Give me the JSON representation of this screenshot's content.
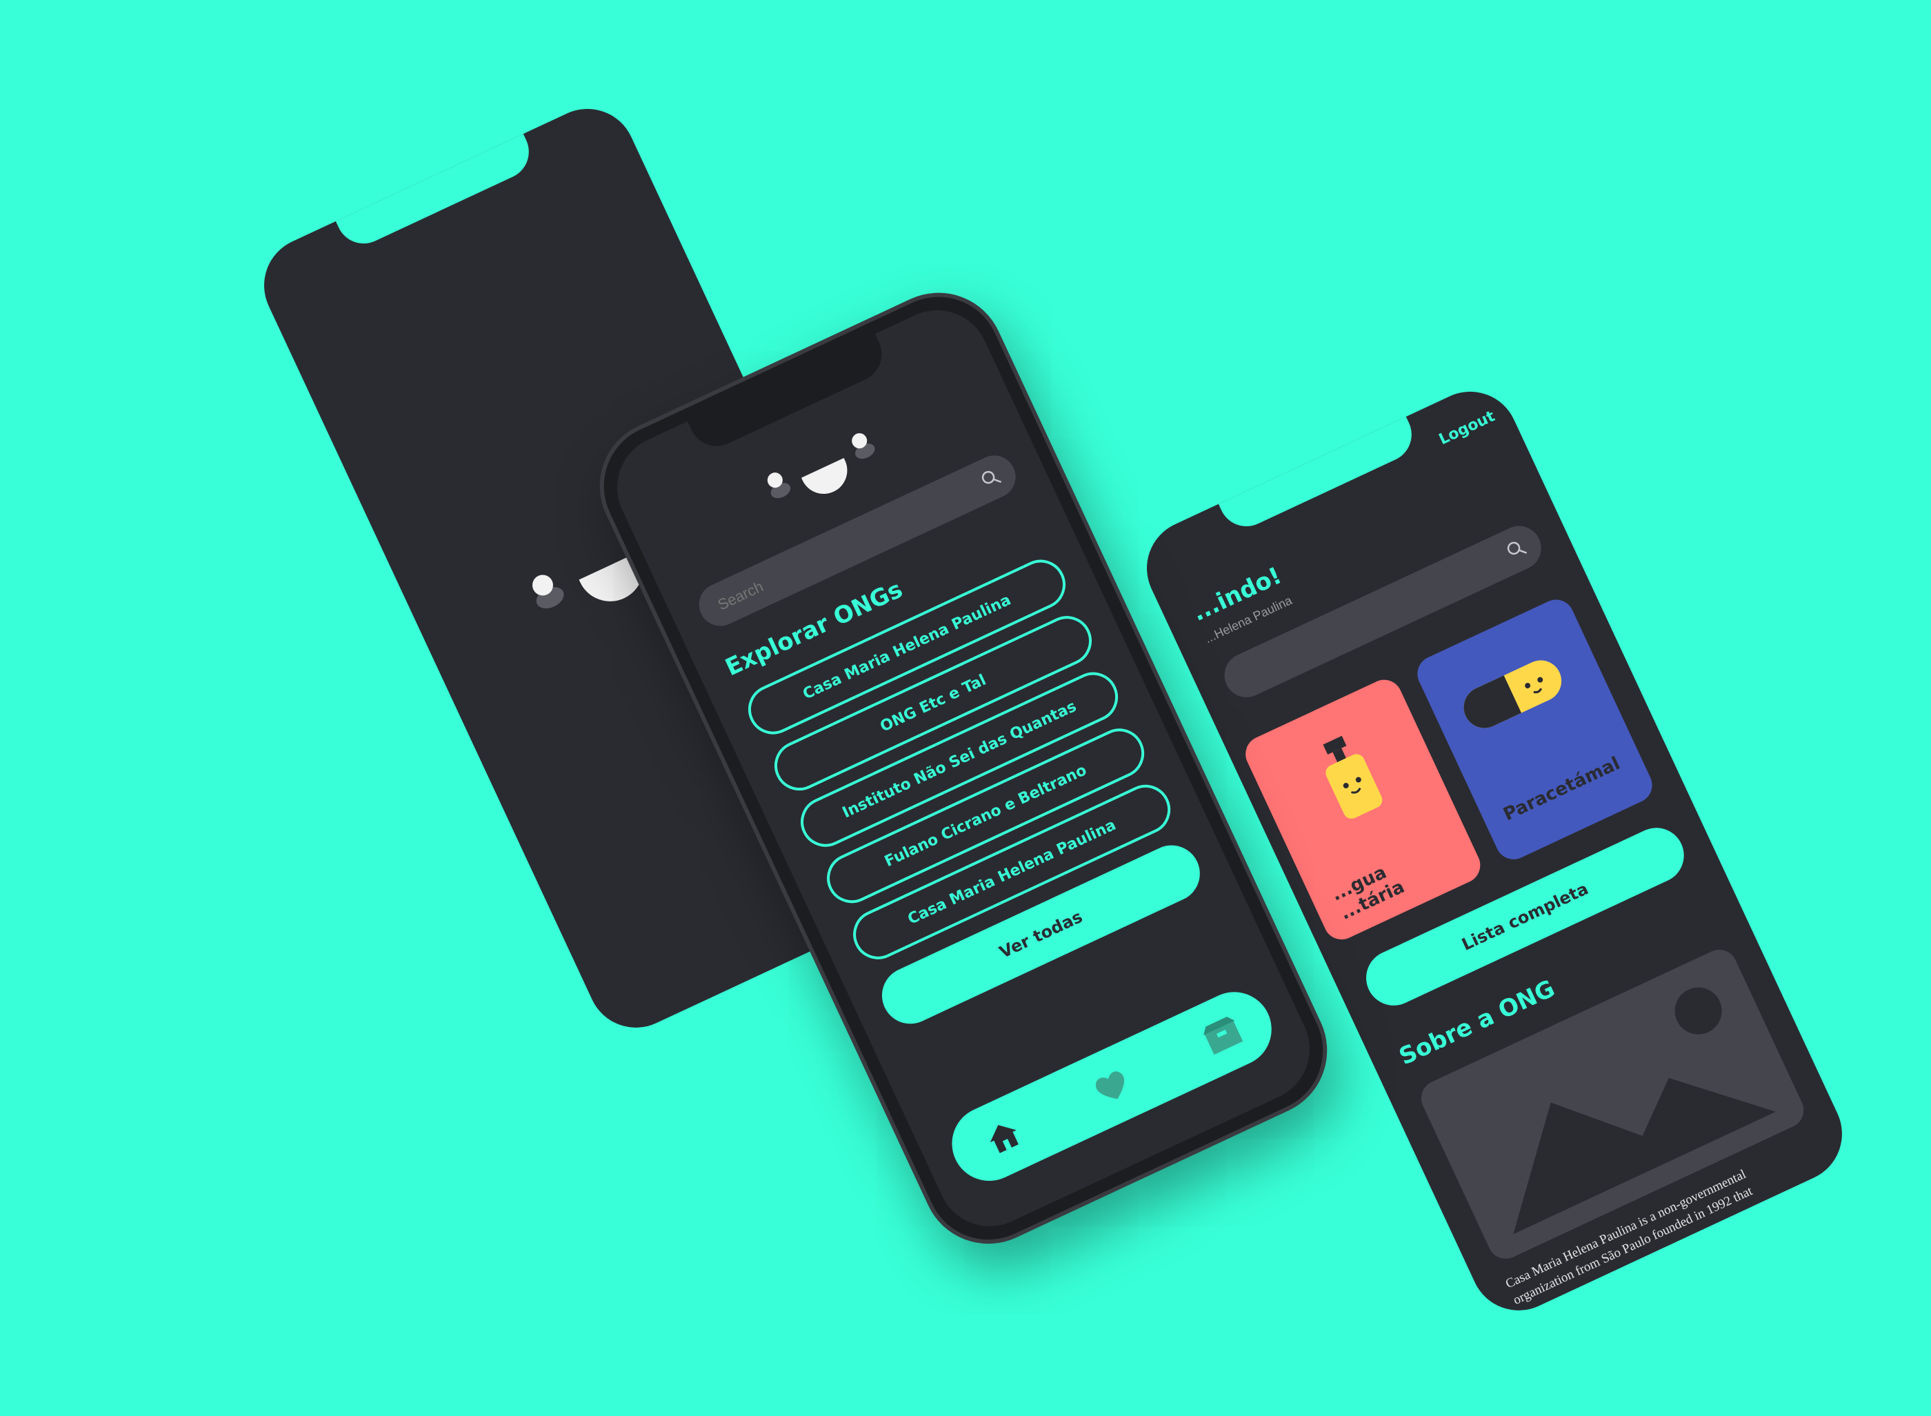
{
  "splash": {
    "face": "smiley-face"
  },
  "explore": {
    "search": {
      "placeholder": "Search"
    },
    "title": "Explorar ONGs",
    "ongs": [
      "Casa Maria Helena Paulina",
      "ONG Etc e Tal",
      "Instituto Não Sei das Quantas",
      "Fulano Cicrano e Beltrano",
      "Casa Maria Helena Paulina"
    ],
    "see_all": "Ver todas",
    "tabs": [
      {
        "icon": "home-icon"
      },
      {
        "icon": "heart-icon"
      },
      {
        "icon": "box-icon"
      }
    ]
  },
  "detail": {
    "logout": "Logout",
    "welcome": "...indo!",
    "subtitle": "...Helena Paulina",
    "cards": [
      {
        "label": "...gua ...tária",
        "color": "#FF7474"
      },
      {
        "label": "Paracetámal",
        "color": "#4459BD"
      }
    ],
    "full_list": "Lista completa",
    "about_title": "Sobre a ONG",
    "about_text_1": "Casa Maria Helena Paulina is a non-governmental",
    "about_text_2": "organization from São Paulo founded in 1992 that"
  },
  "colors": {
    "background": "#38FFD7",
    "screen": "#2A2B31",
    "accent": "#38FFD7",
    "card_red": "#FF7474",
    "card_blue": "#4459BD"
  }
}
